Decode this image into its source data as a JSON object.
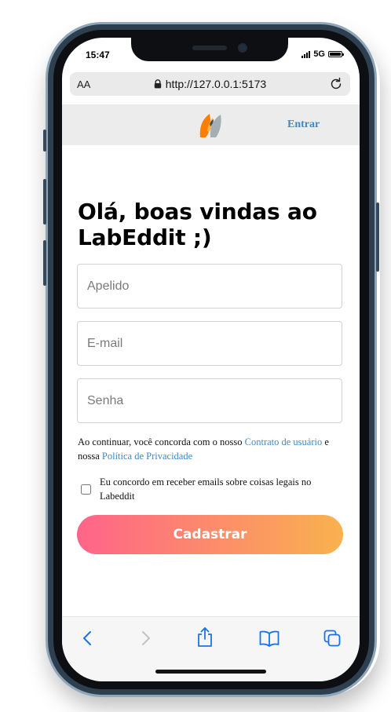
{
  "status_bar": {
    "time": "15:47",
    "network": "5G"
  },
  "browser": {
    "text_size_label": "AA",
    "url": "http://127.0.0.1:5173",
    "icons": {
      "lock": "lock-icon",
      "reload": "reload-icon",
      "back": "back-icon",
      "forward": "forward-icon",
      "share": "share-icon",
      "bookmarks": "bookmarks-icon",
      "tabs": "tabs-icon"
    }
  },
  "header": {
    "logo": "labeddit-logo-icon",
    "login_link": "Entrar"
  },
  "page": {
    "title": "Olá, boas vindas ao LabEddit ;)"
  },
  "form": {
    "nickname_placeholder": "Apelido",
    "email_placeholder": "E-mail",
    "password_placeholder": "Senha",
    "terms": {
      "prefix": "Ao continuar, você concorda com o nosso ",
      "contract_link": "Contrato de usuário",
      "middle": " e nossa ",
      "privacy_link": "Política de Privacidade"
    },
    "newsletter_label": "Eu concordo em receber emails sobre coisas legais no Labeddit",
    "newsletter_checked": false,
    "submit_label": "Cadastrar"
  },
  "colors": {
    "accent_link": "#4088c6",
    "button_gradient_start": "#ff6489",
    "button_gradient_end": "#f9b24e",
    "toolbar_icon": "#1a73e8",
    "phone_frame": "#2e4050"
  }
}
